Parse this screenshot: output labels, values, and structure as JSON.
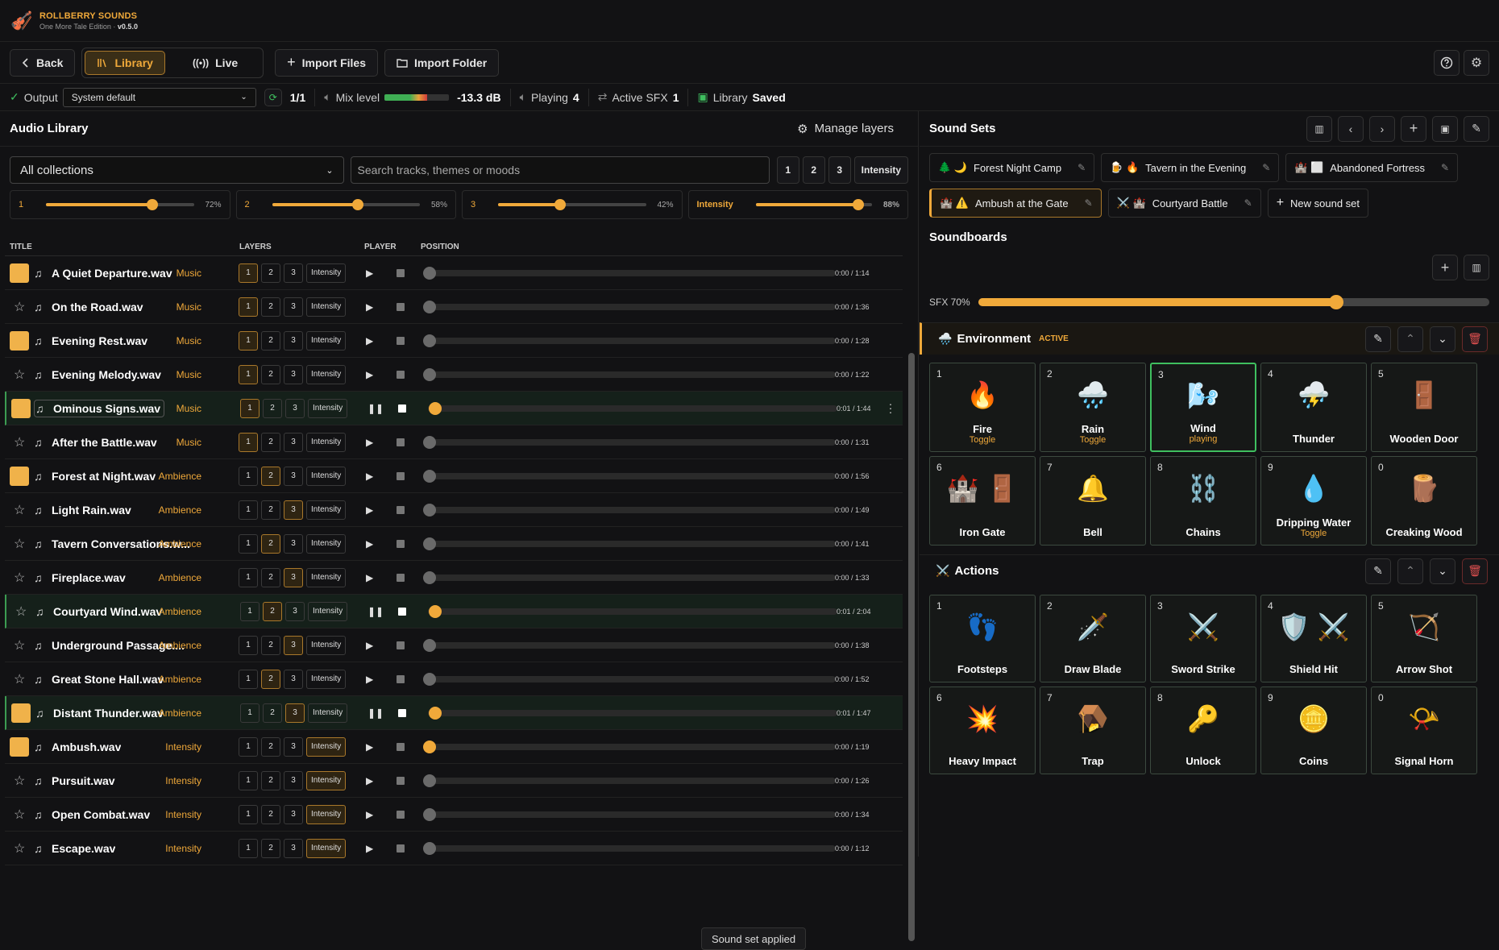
{
  "app": {
    "name": "ROLLBERRY SOUNDS",
    "edition": "One More Tale Edition",
    "version": "v0.5.0",
    "dot": "·"
  },
  "toolbar": {
    "back": "Back",
    "library": "Library",
    "live": "Live",
    "import_files": "Import Files",
    "import_folder": "Import Folder"
  },
  "status": {
    "output_label": "Output",
    "output_value": "System default",
    "output_count": "1/1",
    "mix_label": "Mix level",
    "mix_value": "-13.3 dB",
    "mix_level_fraction": 0.66,
    "playing_label": "Playing",
    "playing_count": "4",
    "sfx_label": "Active SFX",
    "sfx_count": "1",
    "library_label": "Library",
    "library_state": "Saved"
  },
  "library": {
    "title": "Audio Library",
    "manage_layers": "Manage layers",
    "collection": "All collections",
    "search_placeholder": "Search tracks, themes or moods",
    "layer_buttons": [
      "1",
      "2",
      "3",
      "Intensity"
    ],
    "sliders": [
      {
        "label": "1",
        "value": 72,
        "pct": "72%"
      },
      {
        "label": "2",
        "value": 58,
        "pct": "58%"
      },
      {
        "label": "3",
        "value": 42,
        "pct": "42%"
      },
      {
        "label": "Intensity",
        "value": 88,
        "pct": "88%"
      }
    ],
    "columns": {
      "title": "TITLE",
      "layers": "LAYERS",
      "player": "PLAYER",
      "position": "POSITION"
    },
    "tracks": [
      {
        "name": "A Quiet Departure.wav",
        "type": "Music",
        "fav": true,
        "layer": "1",
        "playing": false,
        "progress": 0,
        "time": "0:00 / 1:14"
      },
      {
        "name": "On the Road.wav",
        "type": "Music",
        "fav": false,
        "layer": "1",
        "playing": false,
        "progress": 0,
        "time": "0:00 / 1:36"
      },
      {
        "name": "Evening Rest.wav",
        "type": "Music",
        "fav": true,
        "layer": "1",
        "playing": false,
        "progress": 0,
        "time": "0:00 / 1:28"
      },
      {
        "name": "Evening Melody.wav",
        "type": "Music",
        "fav": false,
        "layer": "1",
        "playing": false,
        "progress": 0,
        "time": "0:00 / 1:22"
      },
      {
        "name": "Ominous Signs.wav",
        "type": "Music",
        "fav": true,
        "layer": "1",
        "playing": true,
        "selected": true,
        "progress": 0.01,
        "time": "0:01 / 1:44"
      },
      {
        "name": "After the Battle.wav",
        "type": "Music",
        "fav": false,
        "layer": "1",
        "playing": false,
        "progress": 0,
        "time": "0:00 / 1:31"
      },
      {
        "name": "Forest at Night.wav",
        "type": "Ambience",
        "fav": true,
        "layer": "2",
        "playing": false,
        "progress": 0,
        "time": "0:00 / 1:56"
      },
      {
        "name": "Light Rain.wav",
        "type": "Ambience",
        "fav": false,
        "layer": "3",
        "playing": false,
        "progress": 0,
        "time": "0:00 / 1:49"
      },
      {
        "name": "Tavern Conversations.w...",
        "type": "Ambience",
        "fav": false,
        "layer": "2",
        "playing": false,
        "progress": 0,
        "time": "0:00 / 1:41"
      },
      {
        "name": "Fireplace.wav",
        "type": "Ambience",
        "fav": false,
        "layer": "3",
        "playing": false,
        "progress": 0,
        "time": "0:00 / 1:33"
      },
      {
        "name": "Courtyard Wind.wav",
        "type": "Ambience",
        "fav": false,
        "layer": "2",
        "playing": true,
        "progress": 0.01,
        "time": "0:01 / 2:04"
      },
      {
        "name": "Underground Passage....",
        "type": "Ambience",
        "fav": false,
        "layer": "3",
        "playing": false,
        "progress": 0,
        "time": "0:00 / 1:38"
      },
      {
        "name": "Great Stone Hall.wav",
        "type": "Ambience",
        "fav": false,
        "layer": "2",
        "playing": false,
        "progress": 0,
        "time": "0:00 / 1:52"
      },
      {
        "name": "Distant Thunder.wav",
        "type": "Ambience",
        "fav": true,
        "layer": "3",
        "playing": true,
        "progress": 0.01,
        "time": "0:01 / 1:47"
      },
      {
        "name": "Ambush.wav",
        "type": "Intensity",
        "fav": true,
        "layer": "Intensity",
        "playing": false,
        "progress": 0,
        "knob_on": true,
        "time": "0:00 / 1:19"
      },
      {
        "name": "Pursuit.wav",
        "type": "Intensity",
        "fav": false,
        "layer": "Intensity",
        "playing": false,
        "progress": 0,
        "time": "0:00 / 1:26"
      },
      {
        "name": "Open Combat.wav",
        "type": "Intensity",
        "fav": false,
        "layer": "Intensity",
        "playing": false,
        "progress": 0,
        "time": "0:00 / 1:34"
      },
      {
        "name": "Escape.wav",
        "type": "Intensity",
        "fav": false,
        "layer": "Intensity",
        "playing": false,
        "progress": 0,
        "time": "0:00 / 1:12"
      }
    ],
    "toast": "Sound set applied"
  },
  "soundsets": {
    "title": "Sound Sets",
    "sets": [
      {
        "icons": "🌲 🌙",
        "name": "Forest Night Camp",
        "active": false
      },
      {
        "icons": "🍺 🔥",
        "name": "Tavern in the Evening",
        "active": false
      },
      {
        "icons": "🏰 ⬜",
        "name": "Abandoned Fortress",
        "active": false
      },
      {
        "icons": "🏰 ⚠️",
        "name": "Ambush at the Gate",
        "active": true
      },
      {
        "icons": "⚔️ 🏰",
        "name": "Courtyard Battle",
        "active": false
      }
    ],
    "new_set": "New sound set"
  },
  "soundboards": {
    "title": "Soundboards",
    "sfx_label": "SFX 70%",
    "sfx_value": 70,
    "groups": [
      {
        "icon": "🌧️",
        "name": "Environment",
        "badge": "ACTIVE",
        "pads": [
          {
            "key": "1",
            "emoji": "🔥",
            "name": "Fire",
            "sub": "Toggle"
          },
          {
            "key": "2",
            "emoji": "🌧️",
            "name": "Rain",
            "sub": "Toggle"
          },
          {
            "key": "3",
            "emoji": "🌬️",
            "name": "Wind",
            "sub": "playing",
            "playing": true
          },
          {
            "key": "4",
            "emoji": "⛈️",
            "name": "Thunder",
            "sub": ""
          },
          {
            "key": "5",
            "emoji": "🚪",
            "name": "Wooden Door",
            "sub": ""
          },
          {
            "key": "6",
            "emoji": "🏰 🚪",
            "name": "Iron Gate",
            "sub": ""
          },
          {
            "key": "7",
            "emoji": "🔔",
            "name": "Bell",
            "sub": ""
          },
          {
            "key": "8",
            "emoji": "⛓️",
            "name": "Chains",
            "sub": ""
          },
          {
            "key": "9",
            "emoji": "💧",
            "name": "Dripping Water",
            "sub": "Toggle"
          },
          {
            "key": "0",
            "emoji": "🪵",
            "name": "Creaking Wood",
            "sub": ""
          }
        ]
      },
      {
        "icon": "⚔️",
        "name": "Actions",
        "badge": "",
        "pads": [
          {
            "key": "1",
            "emoji": "👣",
            "name": "Footsteps",
            "sub": ""
          },
          {
            "key": "2",
            "emoji": "🗡️",
            "name": "Draw Blade",
            "sub": ""
          },
          {
            "key": "3",
            "emoji": "⚔️",
            "name": "Sword Strike",
            "sub": ""
          },
          {
            "key": "4",
            "emoji": "🛡️ ⚔️",
            "name": "Shield Hit",
            "sub": ""
          },
          {
            "key": "5",
            "emoji": "🏹",
            "name": "Arrow Shot",
            "sub": ""
          },
          {
            "key": "6",
            "emoji": "💥",
            "name": "Heavy Impact",
            "sub": ""
          },
          {
            "key": "7",
            "emoji": "🪤",
            "name": "Trap",
            "sub": ""
          },
          {
            "key": "8",
            "emoji": "🔑",
            "name": "Unlock",
            "sub": ""
          },
          {
            "key": "9",
            "emoji": "🪙",
            "name": "Coins",
            "sub": ""
          },
          {
            "key": "0",
            "emoji": "📯",
            "name": "Signal Horn",
            "sub": ""
          }
        ]
      }
    ]
  },
  "colors": {
    "accent": "#f0a93a",
    "playing": "#3fbf5f",
    "bg": "#121214"
  },
  "icons": {
    "back": "chevron-left-icon",
    "library": "books-icon",
    "live": "broadcast-icon",
    "import_files": "plus-icon",
    "import_folder": "folder-icon",
    "help": "help-icon",
    "settings": "gear-icon"
  }
}
